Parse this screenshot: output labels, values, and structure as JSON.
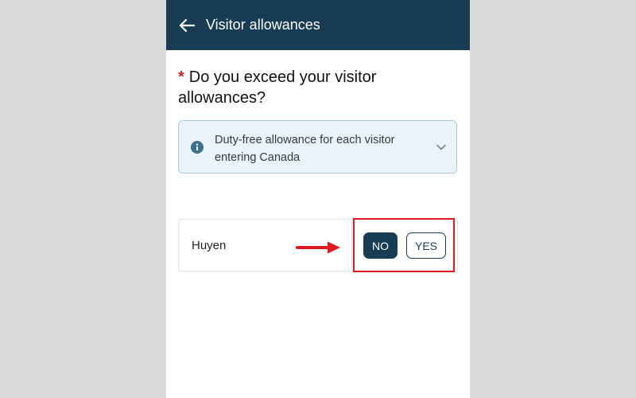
{
  "header": {
    "title": "Visitor allowances",
    "back_icon": "arrow-left-icon",
    "background_color": "#173c54"
  },
  "question": {
    "required_marker": "*",
    "text": "Do you exceed your visitor allowances?"
  },
  "info_panel": {
    "icon": "info-icon",
    "text": "Duty-free allowance for each visitor entering Canada",
    "expand_icon": "chevron-down-icon",
    "background_color": "#eaf4f8"
  },
  "traveller": {
    "name": "Huyen",
    "no_label": "NO",
    "yes_label": "YES",
    "selected": "NO"
  },
  "annotation": {
    "color": "#e0191f",
    "arrow_icon": "red-arrow-icon"
  }
}
